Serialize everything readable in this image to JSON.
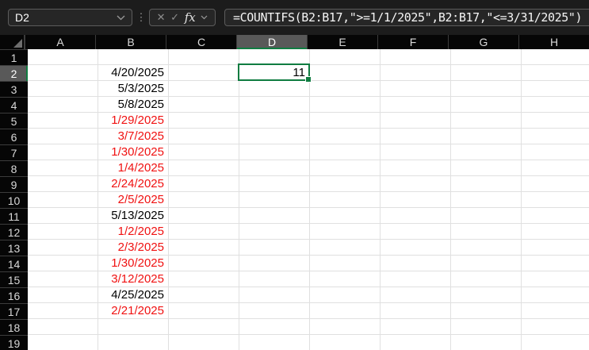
{
  "formula_bar": {
    "cell_reference": "D2",
    "formula": "=COUNTIFS(B2:B17,\">=1/1/2025\",B2:B17,\"<=3/31/2025\")"
  },
  "icons": {
    "cancel": "✕",
    "enter": "✓",
    "insert_function": "fx",
    "grip_dots": "⋮"
  },
  "colors": {
    "topbar_bg": "#1c1c1c",
    "box_bg": "#262626",
    "box_border": "#5c5c5c",
    "header_bg": "#060606",
    "header_selected_bg": "#595959",
    "header_text": "#d8d8d8",
    "cell_bg": "#ffffff",
    "gridline": "#e0e0e0",
    "accent_green": "#107c41",
    "black_text": "#000000",
    "red_text": "#f01111"
  },
  "grid": {
    "column_headers": [
      "A",
      "B",
      "C",
      "D",
      "E",
      "F",
      "G",
      "H"
    ],
    "selected_column": "D",
    "selected_row": 2,
    "active_cell": "D2",
    "active_cell_value": "11",
    "rows": [
      {
        "n": 1,
        "cells": {}
      },
      {
        "n": 2,
        "cells": {
          "B": {
            "text": "4/20/2025",
            "color": "black"
          },
          "D": {
            "text": "11",
            "color": "black"
          }
        }
      },
      {
        "n": 3,
        "cells": {
          "B": {
            "text": "5/3/2025",
            "color": "black"
          }
        }
      },
      {
        "n": 4,
        "cells": {
          "B": {
            "text": "5/8/2025",
            "color": "black"
          }
        }
      },
      {
        "n": 5,
        "cells": {
          "B": {
            "text": "1/29/2025",
            "color": "red"
          }
        }
      },
      {
        "n": 6,
        "cells": {
          "B": {
            "text": "3/7/2025",
            "color": "red"
          }
        }
      },
      {
        "n": 7,
        "cells": {
          "B": {
            "text": "1/30/2025",
            "color": "red"
          }
        }
      },
      {
        "n": 8,
        "cells": {
          "B": {
            "text": "1/4/2025",
            "color": "red"
          }
        }
      },
      {
        "n": 9,
        "cells": {
          "B": {
            "text": "2/24/2025",
            "color": "red"
          }
        }
      },
      {
        "n": 10,
        "cells": {
          "B": {
            "text": "2/5/2025",
            "color": "red"
          }
        }
      },
      {
        "n": 11,
        "cells": {
          "B": {
            "text": "5/13/2025",
            "color": "black"
          }
        }
      },
      {
        "n": 12,
        "cells": {
          "B": {
            "text": "1/2/2025",
            "color": "red"
          }
        }
      },
      {
        "n": 13,
        "cells": {
          "B": {
            "text": "2/3/2025",
            "color": "red"
          }
        }
      },
      {
        "n": 14,
        "cells": {
          "B": {
            "text": "1/30/2025",
            "color": "red"
          }
        }
      },
      {
        "n": 15,
        "cells": {
          "B": {
            "text": "3/12/2025",
            "color": "red"
          }
        }
      },
      {
        "n": 16,
        "cells": {
          "B": {
            "text": "4/25/2025",
            "color": "black"
          }
        }
      },
      {
        "n": 17,
        "cells": {
          "B": {
            "text": "2/21/2025",
            "color": "red"
          }
        }
      },
      {
        "n": 18,
        "cells": {}
      },
      {
        "n": 19,
        "cells": {}
      }
    ]
  }
}
